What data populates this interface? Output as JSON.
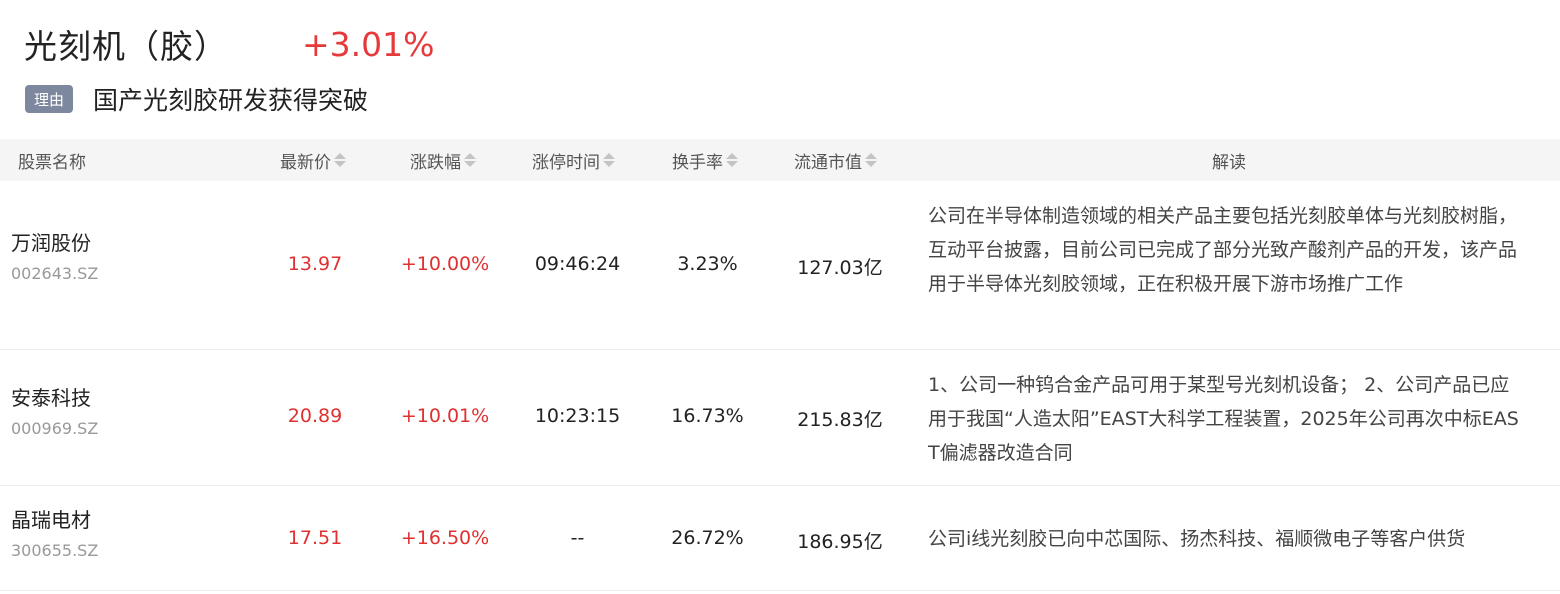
{
  "sector": {
    "title": "光刻机（胶）",
    "change": "+3.01%"
  },
  "reason": {
    "badge": "理由",
    "text": "国产光刻胶研发获得突破"
  },
  "columns": {
    "name": "股票名称",
    "price": "最新价",
    "change": "涨跌幅",
    "limit_time": "涨停时间",
    "turnover": "换手率",
    "market_cap": "流通市值",
    "analysis": "解读"
  },
  "rows": [
    {
      "name": "万润股份",
      "code": "002643.SZ",
      "price": "13.97",
      "change": "+10.00%",
      "limit_time": "09:46:24",
      "turnover": "3.23%",
      "market_cap": "127.03亿",
      "analysis": "公司在半导体制造领域的相关产品主要包括光刻胶单体与光刻胶树脂，互动平台披露，目前公司已完成了部分光致产酸剂产品的开发，该产品用于半导体光刻胶领域，正在积极开展下游市场推广工作"
    },
    {
      "name": "安泰科技",
      "code": "000969.SZ",
      "price": "20.89",
      "change": "+10.01%",
      "limit_time": "10:23:15",
      "turnover": "16.73%",
      "market_cap": "215.83亿",
      "analysis": "1、公司一种钨合金产品可用于某型号光刻机设备； 2、公司产品已应用于我国“人造太阳”EAST大科学工程装置，2025年公司再次中标EAST偏滤器改造合同"
    },
    {
      "name": "晶瑞电材",
      "code": "300655.SZ",
      "price": "17.51",
      "change": "+16.50%",
      "limit_time": "--",
      "turnover": "26.72%",
      "market_cap": "186.95亿",
      "analysis": "公司i线光刻胶已向中芯国际、扬杰科技、福顺微电子等客户供货"
    }
  ]
}
